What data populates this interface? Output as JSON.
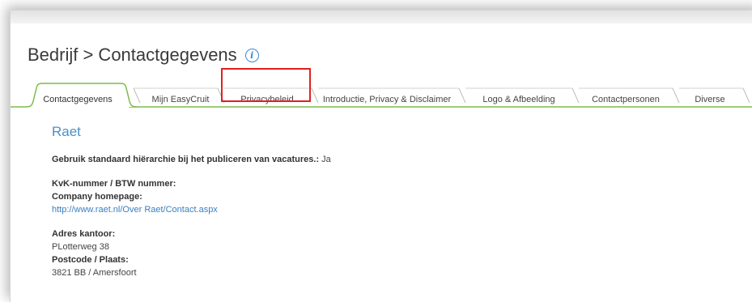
{
  "page": {
    "breadcrumb": "Bedrijf > Contactgegevens",
    "info_icon": "info-icon"
  },
  "tabs": [
    {
      "label": "Contactgegevens",
      "active": true
    },
    {
      "label": "Mijn EasyCruit",
      "active": false
    },
    {
      "label": "Privacybeleid",
      "active": false
    },
    {
      "label": "Introductie, Privacy & Disclaimer",
      "active": false
    },
    {
      "label": "Logo & Afbeelding",
      "active": false
    },
    {
      "label": "Contactpersonen",
      "active": false
    },
    {
      "label": "Diverse",
      "active": false
    }
  ],
  "content": {
    "company_name": "Raet",
    "hierarchy_label": "Gebruik standaard hiërarchie bij het publiceren van vacatures.:",
    "hierarchy_value": " Ja",
    "kvk_label": "KvK-nummer / BTW nummer:",
    "homepage_label": "Company homepage:",
    "homepage_url": "http://www.raet.nl/Over Raet/Contact.aspx",
    "address_label": "Adres kantoor:",
    "address_value": "PLotterweg 38",
    "postcode_label": "Postcode / Plaats:",
    "postcode_value": "3821 BB / Amersfoort"
  },
  "colors": {
    "tab_border": "#7cbb4a",
    "highlight": "#e02020",
    "link": "#3a7fc0"
  }
}
